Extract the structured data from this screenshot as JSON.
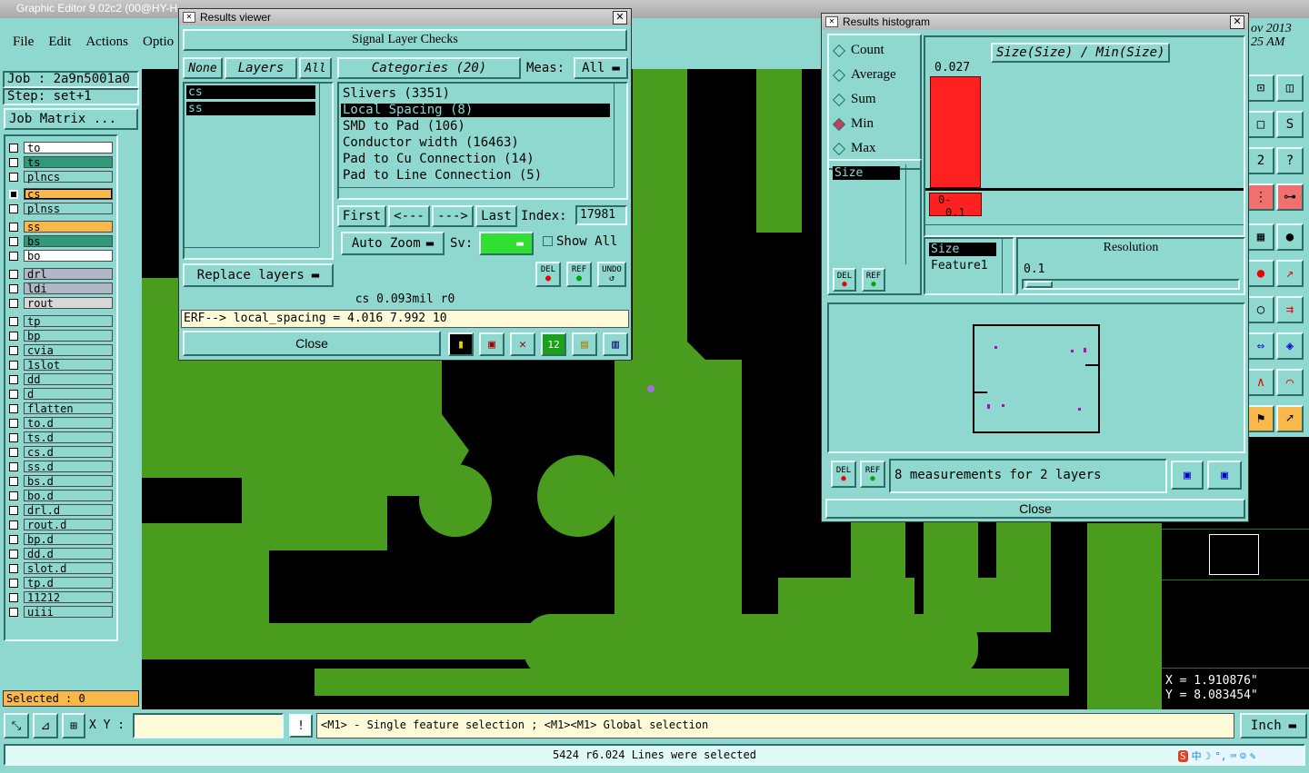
{
  "app": {
    "title": "Graphic Editor 9.02c2 (00@HY-H",
    "date_partial": "ov 2013",
    "time_partial": "25 AM"
  },
  "menu": [
    "File",
    "Edit",
    "Actions",
    "Optio"
  ],
  "job": {
    "label": "Job : 2a9n5001a0",
    "step": "Step: set+1",
    "matrix_btn": "Job Matrix ..."
  },
  "layers": [
    {
      "name": "to",
      "color": "#ffffff"
    },
    {
      "name": "ts",
      "color": "#2e9a7a"
    },
    {
      "name": "plncs",
      "color": "#8fd8d0"
    },
    {
      "name": "cs",
      "color": "#f9b84a",
      "active": true
    },
    {
      "name": "plnss",
      "color": "#8fd8d0"
    },
    {
      "name": "ss",
      "color": "#f9b84a"
    },
    {
      "name": "bs",
      "color": "#2e9a7a"
    },
    {
      "name": "bo",
      "color": "#ffffff"
    },
    {
      "name": "drl",
      "color": "#b0b8c8"
    },
    {
      "name": "ldi",
      "color": "#b0b8c8"
    },
    {
      "name": "rout",
      "color": "#d8d8d8"
    },
    {
      "name": "tp",
      "color": "#8fd8d0"
    },
    {
      "name": "bp",
      "color": "#8fd8d0"
    },
    {
      "name": "cvia",
      "color": "#8fd8d0"
    },
    {
      "name": "1slot",
      "color": "#8fd8d0"
    },
    {
      "name": "dd",
      "color": "#8fd8d0"
    },
    {
      "name": "d",
      "color": "#8fd8d0"
    },
    {
      "name": "flatten",
      "color": "#8fd8d0"
    },
    {
      "name": "to.d",
      "color": "#8fd8d0"
    },
    {
      "name": "ts.d",
      "color": "#8fd8d0"
    },
    {
      "name": "cs.d",
      "color": "#8fd8d0"
    },
    {
      "name": "ss.d",
      "color": "#8fd8d0"
    },
    {
      "name": "bs.d",
      "color": "#8fd8d0"
    },
    {
      "name": "bo.d",
      "color": "#8fd8d0"
    },
    {
      "name": "drl.d",
      "color": "#8fd8d0"
    },
    {
      "name": "rout.d",
      "color": "#8fd8d0"
    },
    {
      "name": "bp.d",
      "color": "#8fd8d0"
    },
    {
      "name": "dd.d",
      "color": "#8fd8d0"
    },
    {
      "name": "slot.d",
      "color": "#8fd8d0"
    },
    {
      "name": "tp.d",
      "color": "#8fd8d0"
    },
    {
      "name": "11212",
      "color": "#8fd8d0"
    },
    {
      "name": "uiii",
      "color": "#8fd8d0"
    }
  ],
  "selected": "Selected : 0",
  "results_viewer": {
    "title": "Results viewer",
    "header": "Signal Layer Checks",
    "none": "None",
    "layers_tab": "Layers",
    "all": "All",
    "layer_list": [
      "cs",
      "ss"
    ],
    "categories": "Categories (20)",
    "meas_label": "Meas:",
    "meas_value": "All",
    "category_list": [
      "Slivers (3351)",
      "Local Spacing (8)",
      "SMD to Pad (106)",
      "Conductor width (16463)",
      "Pad to Cu Connection (14)",
      "Pad to Line Connection (5)"
    ],
    "first": "First",
    "prev": "<---",
    "next": "--->",
    "last": "Last",
    "index_label": "Index:",
    "index_value": "17981",
    "auto_zoom": "Auto Zoom",
    "sv_label": "Sv:",
    "show_all": "Show All",
    "replace_layers": "Replace layers",
    "del": "DEL",
    "ref": "REF",
    "undo": "UNDO",
    "status": "cs 0.093mil  r0",
    "erf": "ERF--> local_spacing = 4.016 7.992 10",
    "close": "Close"
  },
  "histogram": {
    "title": "Results histogram",
    "modes": [
      "Count",
      "Average",
      "Sum",
      "Min",
      "Max"
    ],
    "selected_mode": "Min",
    "heading": "Size(Size) / Min(Size)",
    "bar_value": "0.027",
    "axis_labels": [
      "0-",
      "0.1"
    ],
    "list1": [
      "Size"
    ],
    "list2": [
      "Size",
      "Feature1"
    ],
    "resolution_label": "Resolution",
    "resolution_value": "0.1",
    "measurements": "8 measurements for 2 layers",
    "close": "Close",
    "del": "DEL",
    "ref": "REF"
  },
  "coords": {
    "x": "X = 1.910876\"",
    "y": "Y = 8.083454\""
  },
  "bottom": {
    "xy_label": "X Y :",
    "hint": "<M1> - Single feature selection ; <M1><M1> Global selection",
    "units": "Inch",
    "status": "5424 r6.024 Lines were selected"
  },
  "colors": {
    "board": "#4a9c1f",
    "panel": "#8fd8d0",
    "error_bar": "#ff2020"
  }
}
